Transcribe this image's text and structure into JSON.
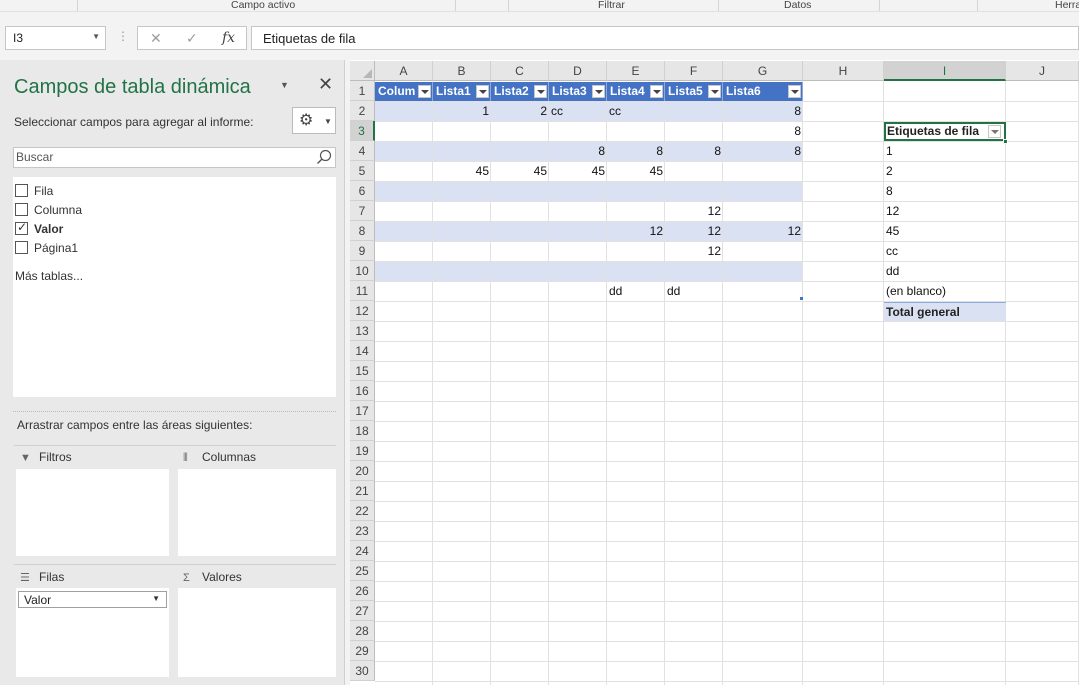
{
  "ribbon": {
    "groups": [
      "Campo activo",
      "Filtrar",
      "Datos",
      "Herra"
    ]
  },
  "formula_bar": {
    "name_box": "I3",
    "cancel_icon": "✕",
    "enter_icon": "✓",
    "fx_icon": "fx",
    "formula": "Etiquetas de fila"
  },
  "pivot_pane": {
    "title": "Campos de tabla dinámica",
    "subtitle": "Seleccionar campos para agregar al informe:",
    "search_placeholder": "Buscar",
    "fields": [
      {
        "label": "Fila",
        "checked": false
      },
      {
        "label": "Columna",
        "checked": false
      },
      {
        "label": "Valor",
        "checked": true
      },
      {
        "label": "Página1",
        "checked": false
      }
    ],
    "more_tables": "Más tablas...",
    "drag_label": "Arrastrar campos entre las áreas siguientes:",
    "areas": {
      "filters": "Filtros",
      "columns": "Columnas",
      "rows": "Filas",
      "values": "Valores",
      "rows_items": [
        "Valor"
      ]
    }
  },
  "sheet": {
    "columns": [
      "A",
      "B",
      "C",
      "D",
      "E",
      "F",
      "G",
      "H",
      "I",
      "J"
    ],
    "selected_column": "I",
    "selected_row": 3,
    "table_headers": [
      "Colum",
      "Lista1",
      "Lista2",
      "Lista3",
      "Lista4",
      "Lista5",
      "Lista6"
    ],
    "cells": [
      {
        "ref": "B2",
        "value": "1",
        "type": "num"
      },
      {
        "ref": "C2",
        "value": "2",
        "type": "num"
      },
      {
        "ref": "D2",
        "value": "cc",
        "type": "txt"
      },
      {
        "ref": "E2",
        "value": "cc",
        "type": "txt"
      },
      {
        "ref": "G2",
        "value": "8",
        "type": "num"
      },
      {
        "ref": "G3",
        "value": "8",
        "type": "num"
      },
      {
        "ref": "D4",
        "value": "8",
        "type": "num"
      },
      {
        "ref": "E4",
        "value": "8",
        "type": "num"
      },
      {
        "ref": "F4",
        "value": "8",
        "type": "num"
      },
      {
        "ref": "G4",
        "value": "8",
        "type": "num"
      },
      {
        "ref": "B5",
        "value": "45",
        "type": "num"
      },
      {
        "ref": "C5",
        "value": "45",
        "type": "num"
      },
      {
        "ref": "D5",
        "value": "45",
        "type": "num"
      },
      {
        "ref": "E5",
        "value": "45",
        "type": "num"
      },
      {
        "ref": "F7",
        "value": "12",
        "type": "num"
      },
      {
        "ref": "E8",
        "value": "12",
        "type": "num"
      },
      {
        "ref": "F8",
        "value": "12",
        "type": "num"
      },
      {
        "ref": "G8",
        "value": "12",
        "type": "num"
      },
      {
        "ref": "F9",
        "value": "12",
        "type": "num"
      },
      {
        "ref": "E11",
        "value": "dd",
        "type": "txt"
      },
      {
        "ref": "F11",
        "value": "dd",
        "type": "txt"
      }
    ],
    "pivot": {
      "header": "Etiquetas de fila",
      "items": [
        "1",
        "2",
        "8",
        "12",
        "45",
        "cc",
        "dd",
        "(en blanco)"
      ],
      "total": "Total general"
    },
    "colors": {
      "table_header": "#4472c4",
      "band": "#d9e1f2",
      "accent": "#217346"
    }
  }
}
